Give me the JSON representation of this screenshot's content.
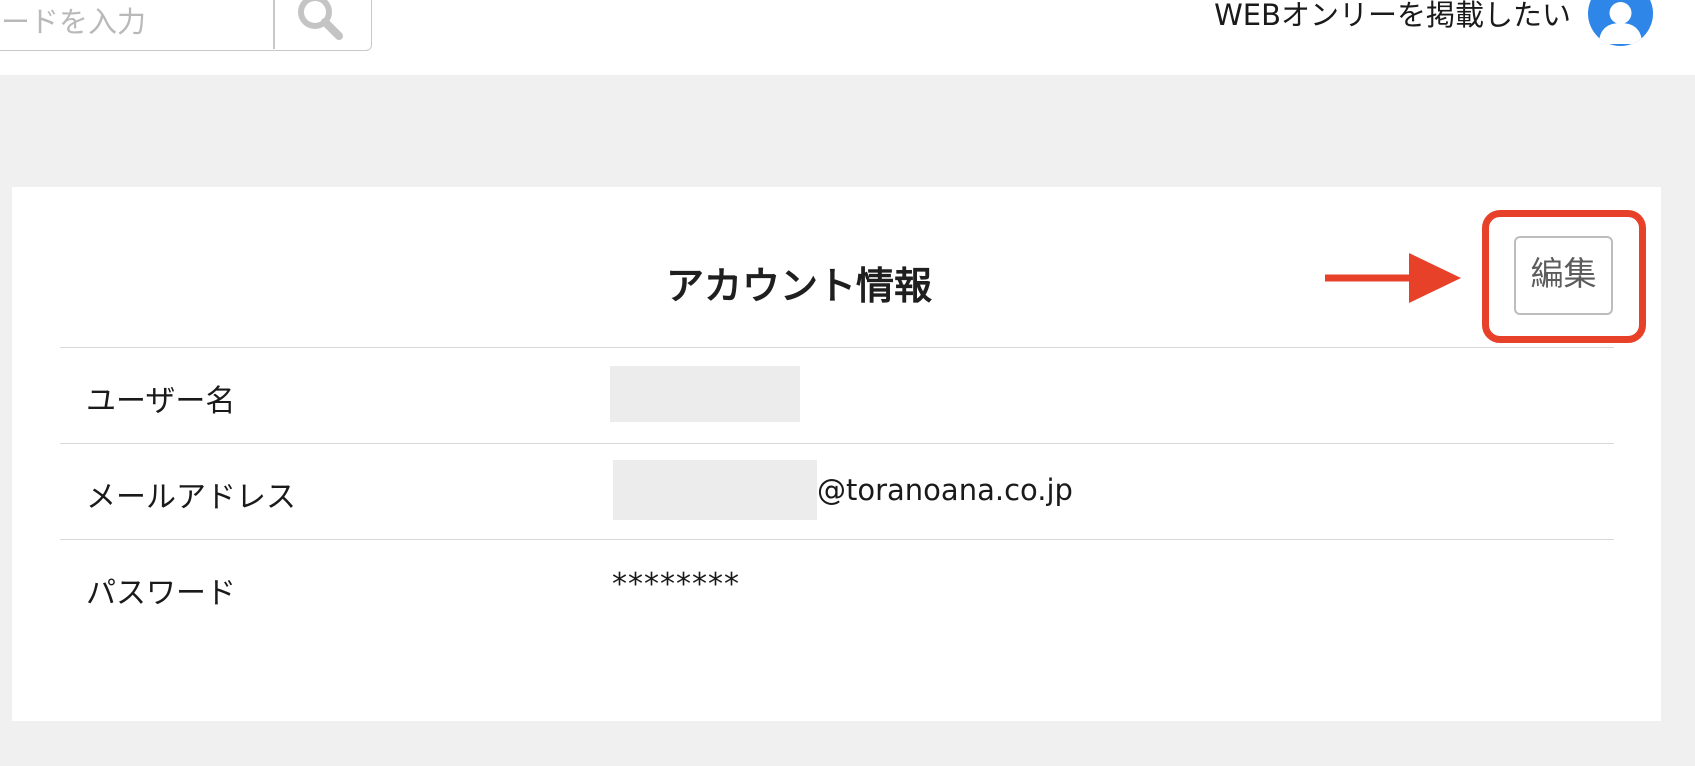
{
  "header": {
    "search_placeholder": "ードを入力",
    "post_link": "WEBオンリーを掲載したい"
  },
  "account": {
    "title": "アカウント情報",
    "edit_label": "編集",
    "rows": [
      {
        "label": "ユーザー名",
        "value": ""
      },
      {
        "label": "メールアドレス",
        "value": "@toranoana.co.jp"
      },
      {
        "label": "パスワード",
        "value": "********"
      }
    ]
  },
  "colors": {
    "annotation": "#e8412a",
    "avatar": "#2e86e8",
    "page_bg": "#f0f0f0"
  },
  "icons": {
    "search": "search-icon",
    "user": "user-icon",
    "arrow": "arrow-right-icon"
  }
}
